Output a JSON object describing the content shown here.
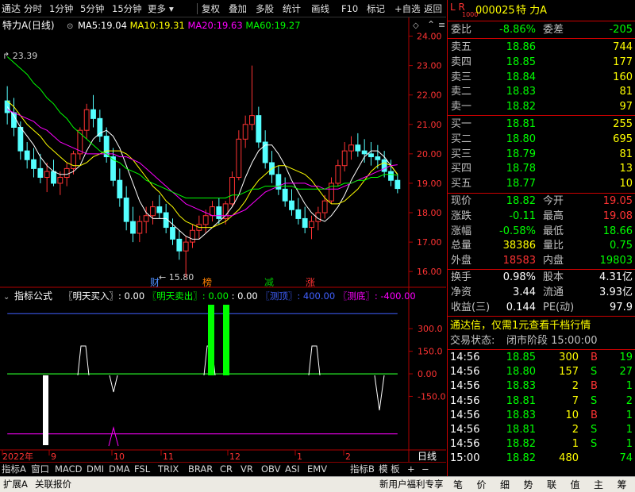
{
  "toolbar": {
    "logo": "通达",
    "left_items": [
      "分时",
      "1分钟",
      "5分钟",
      "15分钟",
      "更多"
    ],
    "right_items": [
      "复权",
      "叠加",
      "多股",
      "统计",
      "画线",
      "F10",
      "标记",
      "+自选",
      "返回"
    ]
  },
  "chart_header": {
    "stock_label": "特力A(日线)",
    "ma": [
      {
        "label": "MA5:",
        "value": "19.04",
        "color": "#ffffff"
      },
      {
        "label": "MA10:",
        "value": "19.31",
        "color": "#ffff00"
      },
      {
        "label": "MA20:",
        "value": "19.63",
        "color": "#ff00ff"
      },
      {
        "label": "MA60:",
        "value": "19.27",
        "color": "#00ff00"
      }
    ]
  },
  "price_marks": {
    "high": "23.39",
    "low": "15.80"
  },
  "markers": [
    {
      "text": "财",
      "color": "#4f8fff"
    },
    {
      "text": "榜",
      "color": "#ff8000"
    },
    {
      "text": "减",
      "color": "#00c000"
    },
    {
      "text": "涨",
      "color": "#ff3333"
    }
  ],
  "indicator_header": {
    "name": "指标公式",
    "items": [
      {
        "text": "〖明天买入〗: 0.00",
        "color": "#ffffff"
      },
      {
        "text": "〖明天卖出〗: 0.00",
        "color": "#00ff00"
      },
      {
        "text": ": 0.00",
        "color": "#ffffff"
      },
      {
        "text": "〖测顶〗: 400.00",
        "color": "#4060ff"
      },
      {
        "text": "〖测底〗: -400.00",
        "color": "#ff00ff"
      }
    ]
  },
  "date_axis": [
    "2022年",
    "9",
    "10",
    "11",
    "12",
    "1",
    "2"
  ],
  "date_axis_right": "日线",
  "bottom_tabs": [
    "指标A",
    "窗口",
    "MACD",
    "DMI",
    "DMA",
    "FSL",
    "TRIX",
    "BRAR",
    "CR",
    "VR",
    "OBV",
    "ASI",
    "EMV",
    "指标B",
    "模 板",
    "+",
    "−"
  ],
  "status_bar": {
    "left": [
      "扩展A",
      "关联报价"
    ],
    "right": "新用户福利专享",
    "rtabs": [
      "笔",
      "价",
      "细",
      "势",
      "联",
      "值",
      "主",
      "筹"
    ]
  },
  "quote": {
    "header": {
      "lr": "L R",
      "exchange_code": "1000",
      "code": "000025",
      "name": "特 力A"
    },
    "wei": {
      "label1": "委比",
      "value1": "-8.86%",
      "label2": "委差",
      "value2": "-205"
    },
    "sell": [
      {
        "label": "卖五",
        "price": "18.86",
        "vol": "744"
      },
      {
        "label": "卖四",
        "price": "18.85",
        "vol": "177"
      },
      {
        "label": "卖三",
        "price": "18.84",
        "vol": "160"
      },
      {
        "label": "卖二",
        "price": "18.83",
        "vol": "81"
      },
      {
        "label": "卖一",
        "price": "18.82",
        "vol": "97"
      }
    ],
    "buy": [
      {
        "label": "买一",
        "price": "18.81",
        "vol": "255"
      },
      {
        "label": "买二",
        "price": "18.80",
        "vol": "695"
      },
      {
        "label": "买三",
        "price": "18.79",
        "vol": "81"
      },
      {
        "label": "买四",
        "price": "18.78",
        "vol": "13"
      },
      {
        "label": "买五",
        "price": "18.77",
        "vol": "10"
      }
    ],
    "stats": [
      {
        "l1": "现价",
        "v1": "18.82",
        "c1": "#00ff00",
        "l2": "今开",
        "v2": "19.05",
        "c2": "#ff3333"
      },
      {
        "l1": "涨跌",
        "v1": "-0.11",
        "c1": "#00ff00",
        "l2": "最高",
        "v2": "19.08",
        "c2": "#ff3333"
      },
      {
        "l1": "涨幅",
        "v1": "-0.58%",
        "c1": "#00ff00",
        "l2": "最低",
        "v2": "18.66",
        "c2": "#00ff00"
      },
      {
        "l1": "总量",
        "v1": "38386",
        "c1": "#ffff00",
        "l2": "量比",
        "v2": "0.75",
        "c2": "#00ff00"
      },
      {
        "l1": "外盘",
        "v1": "18583",
        "c1": "#ff3333",
        "l2": "内盘",
        "v2": "19803",
        "c2": "#00ff00"
      }
    ],
    "stats2": [
      {
        "l1": "换手",
        "v1": "0.98%",
        "l2": "股本",
        "v2": "4.31亿"
      },
      {
        "l1": "净资",
        "v1": "3.44",
        "l2": "流通",
        "v2": "3.93亿"
      },
      {
        "l1": "收益(三)",
        "v1": "0.144",
        "l2": "PE(动)",
        "v2": "97.9"
      }
    ],
    "ad": "通达信，仅需1元查看千档行情",
    "trade_state_label": "交易状态:",
    "trade_state_value": "闭市阶段  15:00:00",
    "ticks": [
      {
        "time": "14:56",
        "price": "18.85",
        "vol": "300",
        "bs": "B",
        "n": "19"
      },
      {
        "time": "14:56",
        "price": "18.80",
        "vol": "157",
        "bs": "S",
        "n": "27"
      },
      {
        "time": "14:56",
        "price": "18.83",
        "vol": "2",
        "bs": "B",
        "n": "1"
      },
      {
        "time": "14:56",
        "price": "18.81",
        "vol": "7",
        "bs": "S",
        "n": "2"
      },
      {
        "time": "14:56",
        "price": "18.83",
        "vol": "10",
        "bs": "B",
        "n": "1"
      },
      {
        "time": "14:56",
        "price": "18.81",
        "vol": "2",
        "bs": "S",
        "n": "1"
      },
      {
        "time": "14:56",
        "price": "18.82",
        "vol": "1",
        "bs": "S",
        "n": "1"
      },
      {
        "time": "15:00",
        "price": "18.82",
        "vol": "480",
        "bs": "",
        "n": "74"
      }
    ]
  },
  "chart_data": [
    {
      "type": "candlestick",
      "title": "特力A(日线)",
      "ylim": [
        15.6,
        24.5
      ],
      "y_ticks": [
        "24.00",
        "23.00",
        "22.00",
        "21.00",
        "20.00",
        "19.00",
        "18.00",
        "17.00",
        "16.00"
      ],
      "candles": [
        [
          21.8,
          22.3,
          21.0,
          21.4
        ],
        [
          21.4,
          21.9,
          20.6,
          20.9
        ],
        [
          20.9,
          21.1,
          19.8,
          20.1
        ],
        [
          20.1,
          20.4,
          19.5,
          19.8
        ],
        [
          19.8,
          20.2,
          19.2,
          19.5
        ],
        [
          19.5,
          20.0,
          19.0,
          19.2
        ],
        [
          19.2,
          19.7,
          18.7,
          19.4
        ],
        [
          19.4,
          19.8,
          18.9,
          19.0
        ],
        [
          19.0,
          19.4,
          18.6,
          19.2
        ],
        [
          19.2,
          19.7,
          18.9,
          19.5
        ],
        [
          19.5,
          20.1,
          19.3,
          20.0
        ],
        [
          20.0,
          20.9,
          19.8,
          20.8
        ],
        [
          20.8,
          21.7,
          20.5,
          21.5
        ],
        [
          21.5,
          22.0,
          20.9,
          21.2
        ],
        [
          21.2,
          21.5,
          20.4,
          20.6
        ],
        [
          20.6,
          20.9,
          19.7,
          19.9
        ],
        [
          19.9,
          20.2,
          18.9,
          19.1
        ],
        [
          19.1,
          19.5,
          18.2,
          18.5
        ],
        [
          18.5,
          18.9,
          17.4,
          17.7
        ],
        [
          17.7,
          18.2,
          17.0,
          17.3
        ],
        [
          17.3,
          17.9,
          17.0,
          17.7
        ],
        [
          17.7,
          18.2,
          17.3,
          17.9
        ],
        [
          17.9,
          18.4,
          17.6,
          18.2
        ],
        [
          18.2,
          18.6,
          17.8,
          18.0
        ],
        [
          18.0,
          18.3,
          17.3,
          17.5
        ],
        [
          17.5,
          17.8,
          16.9,
          17.1
        ],
        [
          17.1,
          17.4,
          16.4,
          16.7
        ],
        [
          16.7,
          17.2,
          15.8,
          17.0
        ],
        [
          17.0,
          17.6,
          16.8,
          17.4
        ],
        [
          17.4,
          17.9,
          17.1,
          17.6
        ],
        [
          17.6,
          18.1,
          17.3,
          17.9
        ],
        [
          17.9,
          18.4,
          17.7,
          18.2
        ],
        [
          18.2,
          18.5,
          17.6,
          17.8
        ],
        [
          17.8,
          18.4,
          17.6,
          18.3
        ],
        [
          18.3,
          19.4,
          18.2,
          19.2
        ],
        [
          19.2,
          20.8,
          19.1,
          20.5
        ],
        [
          20.5,
          21.3,
          20.2,
          21.0
        ],
        [
          21.0,
          23.0,
          20.8,
          21.3
        ],
        [
          21.3,
          21.6,
          20.2,
          20.4
        ],
        [
          20.4,
          20.8,
          19.5,
          19.7
        ],
        [
          19.7,
          20.1,
          19.0,
          19.3
        ],
        [
          19.3,
          19.6,
          18.6,
          18.8
        ],
        [
          18.8,
          19.2,
          18.2,
          18.4
        ],
        [
          18.4,
          18.8,
          17.9,
          18.1
        ],
        [
          18.1,
          18.5,
          17.6,
          17.8
        ],
        [
          17.8,
          18.2,
          17.3,
          17.5
        ],
        [
          17.5,
          17.9,
          17.1,
          17.7
        ],
        [
          17.7,
          18.2,
          17.4,
          18.0
        ],
        [
          18.0,
          18.6,
          17.8,
          18.4
        ],
        [
          18.4,
          19.2,
          18.3,
          19.0
        ],
        [
          19.0,
          19.8,
          18.9,
          19.6
        ],
        [
          19.6,
          20.4,
          19.4,
          20.1
        ],
        [
          20.1,
          20.6,
          19.8,
          20.3
        ],
        [
          20.3,
          20.7,
          19.9,
          20.1
        ],
        [
          20.1,
          20.5,
          19.7,
          20.0
        ],
        [
          20.0,
          20.4,
          19.6,
          19.9
        ],
        [
          19.9,
          20.3,
          19.5,
          19.8
        ],
        [
          19.8,
          20.1,
          19.2,
          19.4
        ],
        [
          19.4,
          19.8,
          18.9,
          19.1
        ],
        [
          19.1,
          19.3,
          18.66,
          18.82
        ]
      ],
      "ma5": [
        21.6,
        21.3,
        20.9,
        20.6,
        20.3,
        19.9,
        19.6,
        19.4,
        19.3,
        19.3,
        19.4,
        19.6,
        20.1,
        20.5,
        20.7,
        20.8,
        20.6,
        20.2,
        19.6,
        19.0,
        18.4,
        18.0,
        17.8,
        17.8,
        17.8,
        17.6,
        17.4,
        17.2,
        17.1,
        17.1,
        17.3,
        17.5,
        17.7,
        17.9,
        18.2,
        18.6,
        19.2,
        19.7,
        20.1,
        20.3,
        20.3,
        20.0,
        19.6,
        19.1,
        18.7,
        18.3,
        18.0,
        17.8,
        17.7,
        17.9,
        18.2,
        18.6,
        19.1,
        19.5,
        19.9,
        20.1,
        20.1,
        19.9,
        19.6,
        19.3
      ],
      "ma10": [
        21.8,
        21.6,
        21.3,
        21.0,
        20.8,
        20.6,
        20.3,
        20.1,
        19.9,
        19.7,
        19.6,
        19.6,
        19.7,
        19.9,
        20.0,
        20.1,
        20.1,
        20.1,
        20.0,
        19.8,
        19.5,
        19.2,
        18.9,
        18.7,
        18.4,
        18.2,
        17.9,
        17.7,
        17.6,
        17.5,
        17.5,
        17.5,
        17.6,
        17.7,
        17.9,
        18.1,
        18.4,
        18.8,
        19.1,
        19.3,
        19.5,
        19.6,
        19.6,
        19.5,
        19.4,
        19.3,
        19.1,
        18.8,
        18.5,
        18.3,
        18.3,
        18.4,
        18.6,
        18.8,
        19.1,
        19.4,
        19.6,
        19.7,
        19.6,
        19.31
      ],
      "ma20": [
        21.5,
        21.4,
        21.3,
        21.2,
        21.1,
        20.9,
        20.8,
        20.6,
        20.4,
        20.3,
        20.2,
        20.1,
        20.0,
        20.0,
        20.0,
        20.0,
        20.0,
        19.9,
        19.9,
        19.8,
        19.7,
        19.5,
        19.3,
        19.1,
        18.9,
        18.7,
        18.5,
        18.3,
        18.2,
        18.1,
        18.0,
        17.9,
        17.9,
        17.9,
        17.9,
        18.0,
        18.1,
        18.3,
        18.5,
        18.7,
        18.8,
        18.9,
        19.0,
        19.0,
        19.0,
        19.0,
        18.9,
        18.9,
        18.8,
        18.8,
        18.8,
        18.9,
        19.0,
        19.1,
        19.2,
        19.3,
        19.4,
        19.5,
        19.6,
        19.63
      ],
      "ma60": [
        23.3,
        23.1,
        22.9,
        22.7,
        22.4,
        22.2,
        21.9,
        21.7,
        21.4,
        21.2,
        20.9,
        20.7,
        20.5,
        20.3,
        20.1,
        20.0,
        19.8,
        19.7,
        19.5,
        19.4,
        19.3,
        19.1,
        19.0,
        18.9,
        18.8,
        18.7,
        18.6,
        18.5,
        18.5,
        18.5,
        18.5,
        18.5,
        18.5,
        18.5,
        18.6,
        18.6,
        18.7,
        18.8,
        18.8,
        18.9,
        18.9,
        18.9,
        18.9,
        18.9,
        18.8,
        18.8,
        18.8,
        18.8,
        18.8,
        18.9,
        18.9,
        19.0,
        19.0,
        19.1,
        19.1,
        19.2,
        19.2,
        19.3,
        19.3,
        19.27
      ]
    },
    {
      "type": "line",
      "title": "指标公式",
      "ylim": [
        -480,
        470
      ],
      "y_ticks": [
        "300.0",
        "150.0",
        "0.00",
        "-150.0"
      ],
      "series": [
        {
          "name": "明天买入",
          "values": [
            0,
            0,
            0,
            0,
            0,
            0,
            0,
            0,
            0,
            0,
            0,
            0,
            0,
            0,
            0,
            0,
            0,
            0,
            0,
            0,
            0,
            0,
            0,
            0,
            0,
            0,
            0,
            0,
            0,
            0,
            0,
            0,
            0,
            0,
            0,
            0,
            0,
            0,
            0,
            0,
            0,
            0,
            0,
            0,
            0,
            0,
            0,
            0,
            0,
            0,
            0,
            0,
            0,
            0,
            0,
            0,
            0,
            0,
            0,
            0
          ]
        },
        {
          "name": "明天卖出",
          "values": [
            0,
            0,
            0,
            0,
            0,
            0,
            0,
            0,
            0,
            0,
            0,
            0,
            0,
            0,
            0,
            0,
            0,
            0,
            0,
            0,
            0,
            0,
            0,
            0,
            0,
            0,
            0,
            0,
            0,
            0,
            0,
            0,
            0,
            0,
            0,
            0,
            0,
            0,
            0,
            0,
            0,
            0,
            0,
            0,
            0,
            0,
            0,
            0,
            0,
            0,
            0,
            0,
            0,
            0,
            0,
            0,
            0,
            0,
            0,
            0
          ]
        },
        {
          "name": "测顶",
          "values": [
            400,
            400,
            400,
            400,
            400,
            400,
            400,
            400,
            400,
            400,
            400,
            400,
            400,
            400,
            400,
            400,
            400,
            400,
            400,
            400,
            400,
            400,
            400,
            400,
            400,
            400,
            400,
            400,
            400,
            400,
            400,
            400,
            400,
            400,
            400,
            400,
            400,
            400,
            400,
            400,
            400,
            400,
            400,
            400,
            400,
            400,
            400,
            400,
            400,
            400,
            400,
            400,
            400,
            400,
            400,
            400,
            400,
            400,
            400,
            400
          ]
        },
        {
          "name": "测底",
          "values": [
            -400,
            -400,
            -400,
            -400,
            -400,
            -400,
            -400,
            -400,
            -400,
            -400,
            -400,
            -400,
            -400,
            -400,
            -400,
            -400,
            -400,
            -400,
            -400,
            -400,
            -400,
            -400,
            -400,
            -400,
            -400,
            -400,
            -400,
            -400,
            -400,
            -400,
            -400,
            -400,
            -400,
            -400,
            -400,
            -400,
            -400,
            -400,
            -400,
            -400,
            -400,
            -400,
            -400,
            -400,
            -400,
            -400,
            -400,
            -400,
            -400,
            -400,
            -400,
            -400,
            -400,
            -400,
            -400,
            -400,
            -400,
            -400,
            -400,
            -400
          ]
        }
      ]
    }
  ]
}
